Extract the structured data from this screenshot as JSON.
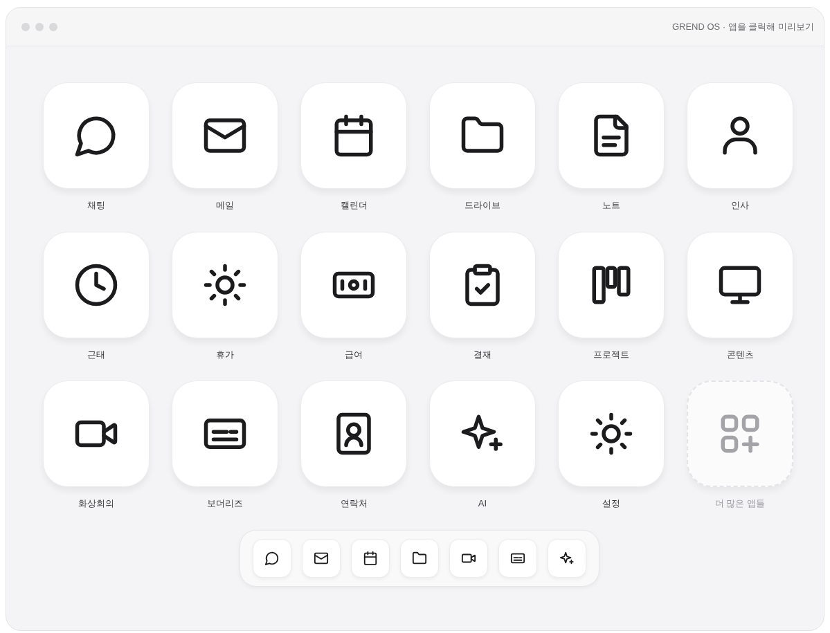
{
  "window": {
    "title": "GREND OS · 앱을 클릭해 미리보기"
  },
  "apps": [
    {
      "label": "채팅",
      "kind": "chat"
    },
    {
      "label": "메일",
      "kind": "mail"
    },
    {
      "label": "캘린더",
      "kind": "calendar"
    },
    {
      "label": "드라이브",
      "kind": "folder"
    },
    {
      "label": "노트",
      "kind": "note"
    },
    {
      "label": "인사",
      "kind": "user"
    },
    {
      "label": "근태",
      "kind": "clock"
    },
    {
      "label": "휴가",
      "kind": "sun"
    },
    {
      "label": "급여",
      "kind": "money"
    },
    {
      "label": "결재",
      "kind": "clipboard"
    },
    {
      "label": "프로젝트",
      "kind": "kanban"
    },
    {
      "label": "콘텐츠",
      "kind": "monitor"
    },
    {
      "label": "화상회의",
      "kind": "video"
    },
    {
      "label": "보더리즈",
      "kind": "card"
    },
    {
      "label": "연락처",
      "kind": "contact"
    },
    {
      "label": "AI",
      "kind": "sparkles"
    },
    {
      "label": "설정",
      "kind": "sun"
    },
    {
      "label": "더 많은 앱들",
      "kind": "more"
    }
  ],
  "dock": [
    {
      "kind": "chat"
    },
    {
      "kind": "mail"
    },
    {
      "kind": "calendar"
    },
    {
      "kind": "folder"
    },
    {
      "kind": "video"
    },
    {
      "kind": "card"
    },
    {
      "kind": "sparkles"
    }
  ]
}
